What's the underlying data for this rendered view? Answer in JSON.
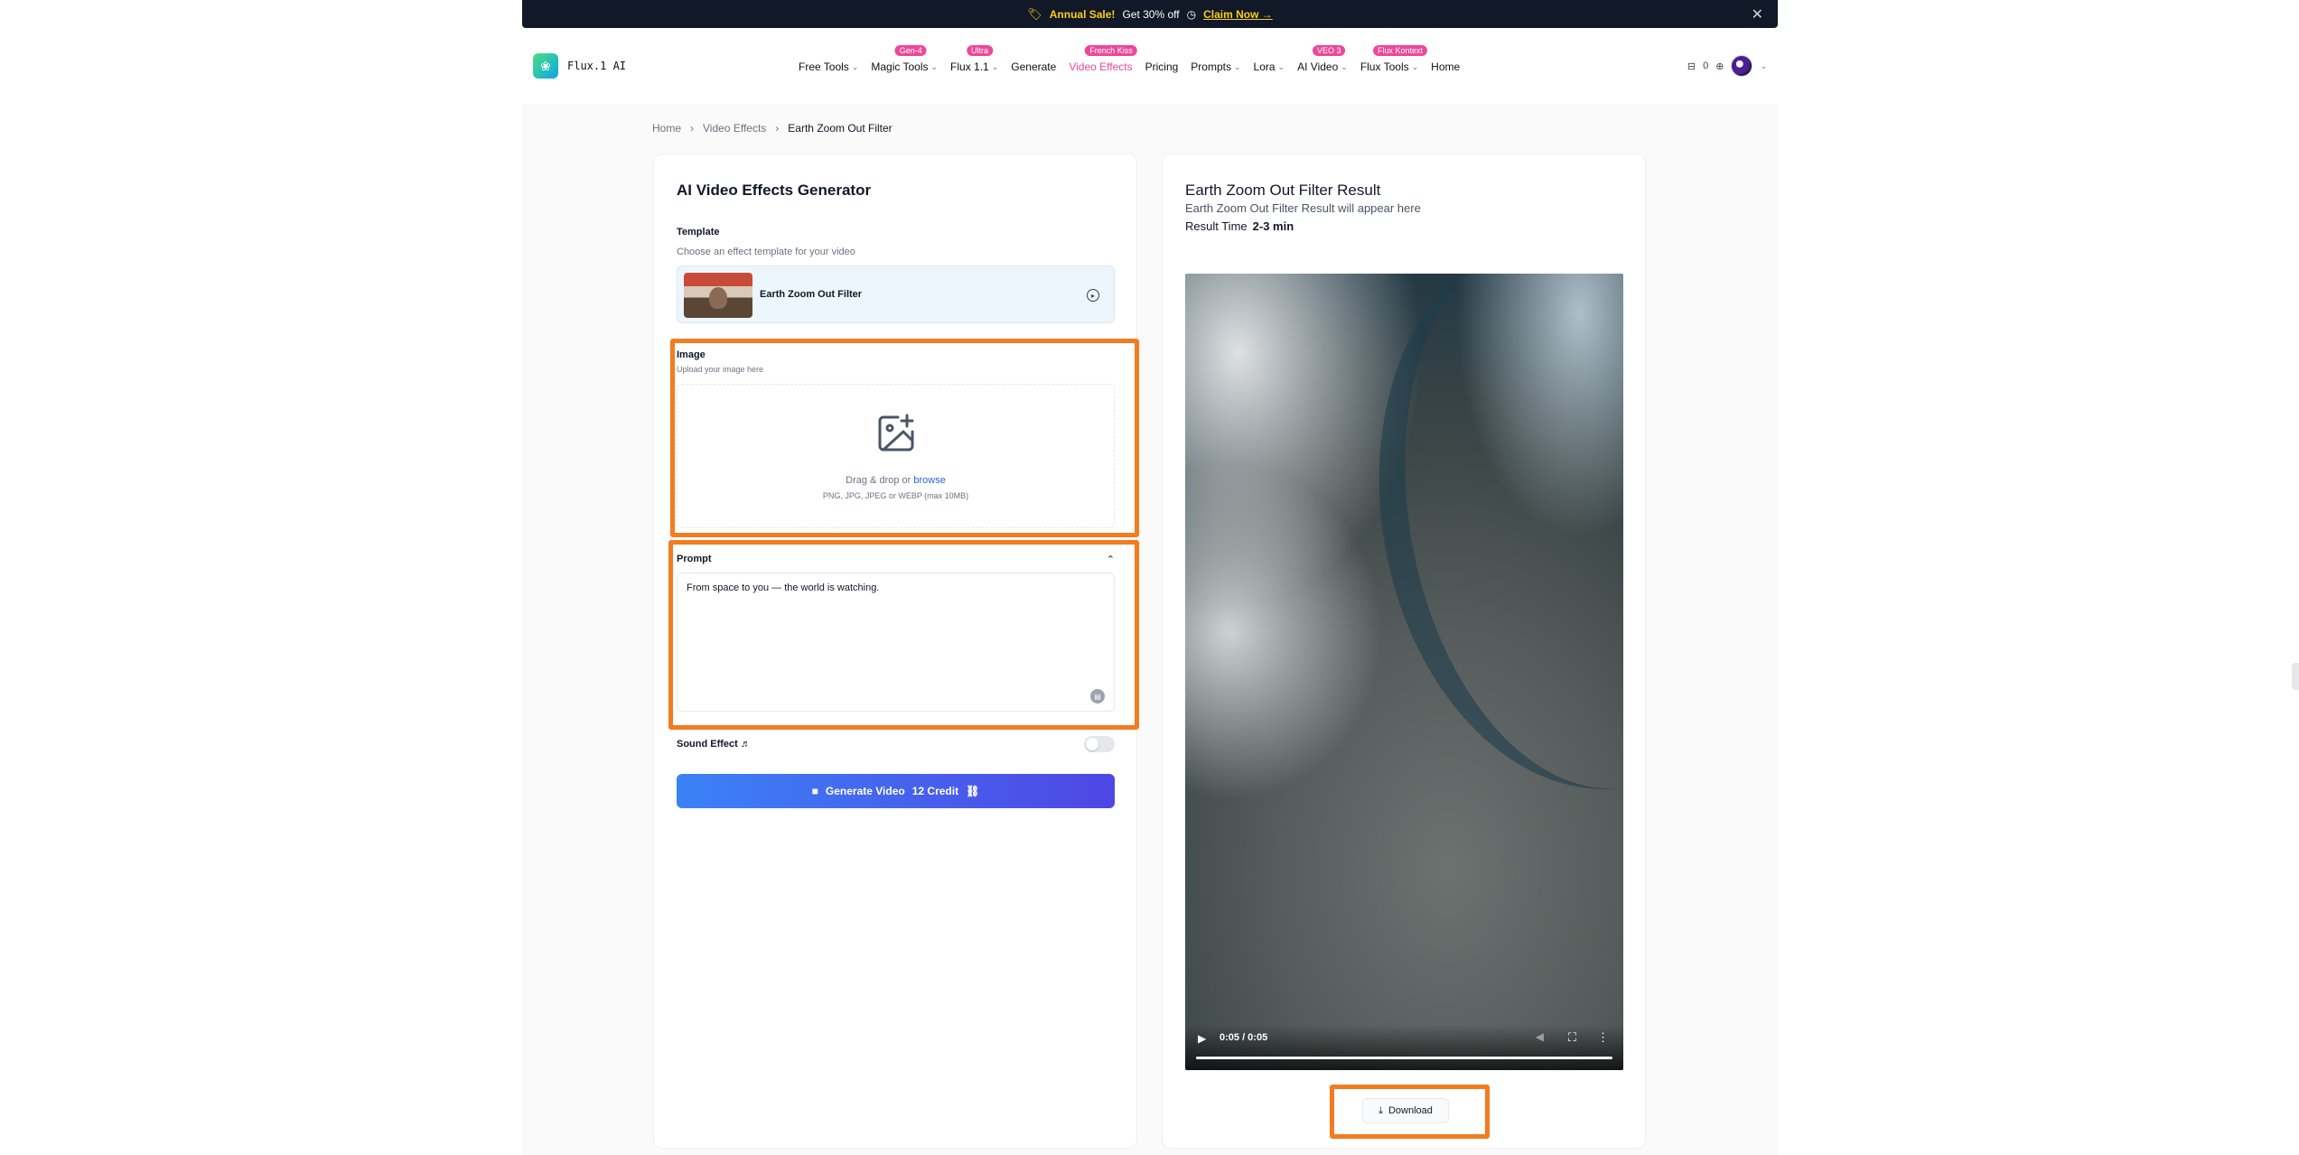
{
  "banner": {
    "tag_icon": "🏷",
    "sale_label": "Annual Sale!",
    "offer_text": "Get 30% off",
    "claim_label": "Claim Now →",
    "close_icon": "✕"
  },
  "header": {
    "logo_text": "Flux.1 AI",
    "nav": [
      {
        "label": "Free Tools",
        "caret": "⌄",
        "badge": ""
      },
      {
        "label": "Magic Tools",
        "caret": "⌄",
        "badge": "Gen-4"
      },
      {
        "label": "Flux 1.1",
        "caret": "⌄",
        "badge": "Ultra"
      },
      {
        "label": "Generate",
        "caret": "",
        "badge": ""
      },
      {
        "label": "Video Effects",
        "caret": "",
        "badge": "French Kiss"
      },
      {
        "label": "Pricing",
        "caret": "",
        "badge": ""
      },
      {
        "label": "Prompts",
        "caret": "⌄",
        "badge": ""
      },
      {
        "label": "Lora",
        "caret": "⌄",
        "badge": ""
      },
      {
        "label": "AI Video",
        "caret": "⌄",
        "badge": "VEO 3"
      },
      {
        "label": "Flux Tools",
        "caret": "⌄",
        "badge": "Flux Kontext"
      },
      {
        "label": "Home",
        "caret": "",
        "badge": ""
      }
    ],
    "credits": "0",
    "badge_color": "#ec4899",
    "accent_color": "#ec4899"
  },
  "breadcrumb": {
    "home": "Home",
    "section": "Video Effects",
    "current": "Earth Zoom Out Filter",
    "separator": "›"
  },
  "left": {
    "title": "AI Video Effects Generator",
    "template_label": "Template",
    "template_hint": "Choose an effect template for your video",
    "template_name": "Earth Zoom Out Filter",
    "image_label": "Image",
    "image_hint": "Upload your image here",
    "drag_text": "Drag & drop or",
    "browse_label": "browse",
    "formats": "PNG, JPG, JPEG or WEBP (max 10MB)",
    "prompt_label": "Prompt",
    "prompt_value": "From space to you — the world is watching.",
    "sound_label": "Sound Effect",
    "sound_icon": "♬",
    "generate_label": "Generate Video",
    "credit_label": "12 Credit",
    "button_color": "#4f46e5"
  },
  "right": {
    "title": "Earth Zoom Out Filter Result",
    "subtitle": "Earth Zoom Out Filter Result will appear here",
    "time_label": "Result Time",
    "time_value": "2-3 min",
    "video_time": "0:05 / 0:05",
    "download_label": "Download"
  },
  "highlight_color": "#f47b20"
}
